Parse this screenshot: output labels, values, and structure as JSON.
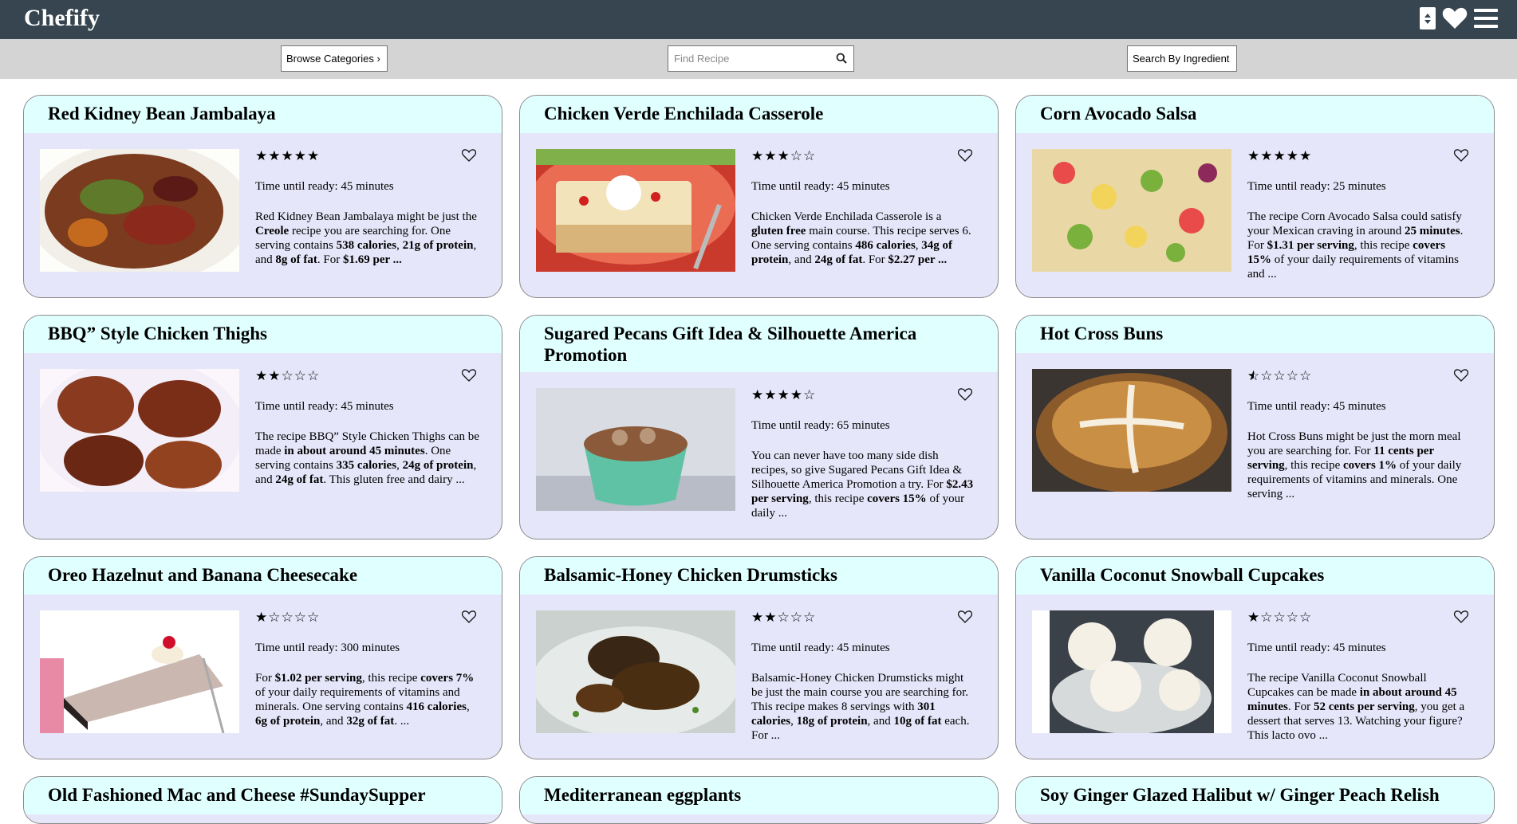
{
  "app": {
    "title": "Chefify"
  },
  "topbar": {
    "icons": [
      "sort-icon",
      "heart-icon",
      "hamburger-menu-icon"
    ]
  },
  "toolbar": {
    "browse_label": "Browse Categories ›",
    "search_placeholder": "Find Recipe",
    "ingredient_label": "Search By Ingredient"
  },
  "colors": {
    "topbar": "#36454f",
    "toolbar": "#d4d4d4",
    "card_bg": "#e6e6fa",
    "card_title_bg": "#e0ffff"
  },
  "recipes": [
    {
      "title": "Red Kidney Bean Jambalaya",
      "rating": 5,
      "time": "Time until ready: 45 minutes",
      "summary": [
        [
          "Red Kidney Bean Jambalaya might be just the ",
          false
        ],
        [
          "Creole",
          true
        ],
        [
          " recipe you are searching for. One serving contains ",
          false
        ],
        [
          "538 calories",
          true
        ],
        [
          ", ",
          false
        ],
        [
          "21g of protein",
          true
        ],
        [
          ", and ",
          false
        ],
        [
          "8g of fat",
          true
        ],
        [
          ". For ",
          false
        ],
        [
          "$1.69 per ...",
          true
        ]
      ]
    },
    {
      "title": "Chicken Verde Enchilada Casserole",
      "rating": 3,
      "time": "Time until ready: 45 minutes",
      "summary": [
        [
          "Chicken Verde Enchilada Casserole is a ",
          false
        ],
        [
          "gluten free",
          true
        ],
        [
          " main course. This recipe serves 6. One serving contains ",
          false
        ],
        [
          "486 calories",
          true
        ],
        [
          ", ",
          false
        ],
        [
          "34g of protein",
          true
        ],
        [
          ", and ",
          false
        ],
        [
          "24g of fat",
          true
        ],
        [
          ". For ",
          false
        ],
        [
          "$2.27 per ...",
          true
        ]
      ]
    },
    {
      "title": "Corn Avocado Salsa",
      "rating": 5,
      "time": "Time until ready: 25 minutes",
      "summary": [
        [
          "The recipe Corn Avocado Salsa could satisfy your Mexican craving in around ",
          false
        ],
        [
          "25 minutes",
          true
        ],
        [
          ". For ",
          false
        ],
        [
          "$1.31 per serving",
          true
        ],
        [
          ", this recipe ",
          false
        ],
        [
          "covers 15%",
          true
        ],
        [
          " of your daily requirements of vitamins and ...",
          false
        ]
      ]
    },
    {
      "title": "BBQ” Style Chicken Thighs",
      "rating": 2,
      "time": "Time until ready: 45 minutes",
      "summary": [
        [
          "The recipe BBQ” Style Chicken Thighs can be made ",
          false
        ],
        [
          "in about around 45 minutes",
          true
        ],
        [
          ". One serving contains ",
          false
        ],
        [
          "335 calories",
          true
        ],
        [
          ", ",
          false
        ],
        [
          "24g of protein",
          true
        ],
        [
          ", and ",
          false
        ],
        [
          "24g of fat",
          true
        ],
        [
          ". This gluten free and dairy ...",
          false
        ]
      ]
    },
    {
      "title": "Sugared Pecans Gift Idea & Silhouette America Promotion",
      "rating": 4,
      "time": "Time until ready: 65 minutes",
      "summary": [
        [
          "You can never have too many side dish recipes, so give Sugared Pecans Gift Idea & Silhouette America Promotion a try. For ",
          false
        ],
        [
          "$2.43 per serving",
          true
        ],
        [
          ", this recipe ",
          false
        ],
        [
          "covers 15%",
          true
        ],
        [
          " of your daily ...",
          false
        ]
      ]
    },
    {
      "title": "Hot Cross Buns",
      "rating": 0.5,
      "time": "Time until ready: 45 minutes",
      "summary": [
        [
          "Hot Cross Buns might be just the morn meal you are searching for. For ",
          false
        ],
        [
          "11 cents per serving",
          true
        ],
        [
          ", this recipe ",
          false
        ],
        [
          "covers 1%",
          true
        ],
        [
          " of your daily requirements of vitamins and minerals. One serving ...",
          false
        ]
      ]
    },
    {
      "title": "Oreo Hazelnut and Banana Cheesecake",
      "rating": 1,
      "time": "Time until ready: 300 minutes",
      "summary": [
        [
          "For ",
          false
        ],
        [
          "$1.02 per serving",
          true
        ],
        [
          ", this recipe ",
          false
        ],
        [
          "covers 7%",
          true
        ],
        [
          " of your daily requirements of vitamins and minerals. One serving contains ",
          false
        ],
        [
          "416 calories",
          true
        ],
        [
          ", ",
          false
        ],
        [
          "6g of protein",
          true
        ],
        [
          ", and ",
          false
        ],
        [
          "32g of fat",
          true
        ],
        [
          ". ...",
          false
        ]
      ]
    },
    {
      "title": "Balsamic-Honey Chicken Drumsticks",
      "rating": 2,
      "time": "Time until ready: 45 minutes",
      "summary": [
        [
          "Balsamic-Honey Chicken Drumsticks might be just the main course you are searching for. This recipe makes 8 servings with ",
          false
        ],
        [
          "301 calories",
          true
        ],
        [
          ", ",
          false
        ],
        [
          "18g of protein",
          true
        ],
        [
          ", and ",
          false
        ],
        [
          "10g of fat",
          true
        ],
        [
          " each. For ...",
          false
        ]
      ]
    },
    {
      "title": "Vanilla Coconut Snowball Cupcakes",
      "rating": 1,
      "time": "Time until ready: 45 minutes",
      "summary": [
        [
          "The recipe Vanilla Coconut Snowball Cupcakes can be made ",
          false
        ],
        [
          "in about around 45 minutes",
          true
        ],
        [
          ". For ",
          false
        ],
        [
          "52 cents per serving",
          true
        ],
        [
          ", you get a dessert that serves 13. Watching your figure? This lacto ovo ...",
          false
        ]
      ]
    },
    {
      "title": "Old Fashioned Mac and Cheese #SundaySupper"
    },
    {
      "title": "Mediterranean eggplants"
    },
    {
      "title": "Soy Ginger Glazed Halibut w/ Ginger Peach Relish"
    }
  ]
}
